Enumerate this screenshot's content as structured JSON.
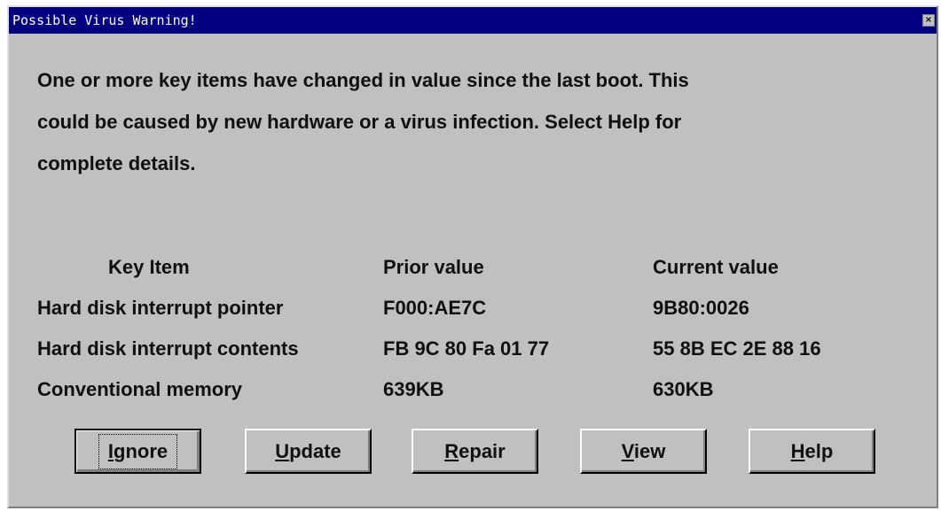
{
  "window": {
    "title": "Possible Virus Warning!",
    "close_glyph": "×"
  },
  "message": {
    "lines": [
      "One or more key items have changed in value since the last boot. This",
      "could be caused by new hardware or a virus infection. Select Help for",
      "complete details."
    ]
  },
  "table": {
    "headers": [
      "Key Item",
      "Prior value",
      "Current value"
    ],
    "rows": [
      [
        "Hard disk interrupt pointer",
        "F000:AE7C",
        "9B80:0026"
      ],
      [
        "Hard disk interrupt contents",
        "FB 9C 80 Fa 01 77",
        "55 8B EC 2E 88 16"
      ],
      [
        "Conventional memory",
        "639KB",
        "630KB"
      ]
    ]
  },
  "buttons": [
    {
      "mnemonic": "I",
      "rest": "gnore"
    },
    {
      "mnemonic": "U",
      "rest": "pdate"
    },
    {
      "mnemonic": "R",
      "rest": "epair"
    },
    {
      "mnemonic": "V",
      "rest": "iew"
    },
    {
      "mnemonic": "H",
      "rest": "elp"
    }
  ],
  "colors": {
    "titlebar": "#000080",
    "face": "#c0c0c0",
    "text": "#101010"
  }
}
